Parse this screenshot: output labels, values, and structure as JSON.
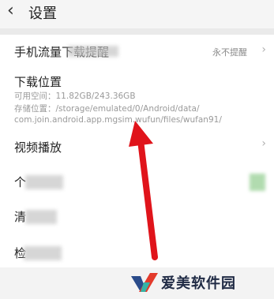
{
  "header": {
    "back_icon": "chevron-left-icon",
    "title": "设置"
  },
  "settings": {
    "row1": {
      "label": "手机流量下载提醒",
      "value": "永不提醒"
    },
    "row2": {
      "label": "下载位置",
      "available": "可用空间：11.82GB/243.36GB",
      "path_line1": "存储位置：/storage/emulated/0/Android/data/",
      "path_line2": "com.join.android.app.mgsim.wufun/files/wufan91/"
    },
    "row3": {
      "label": "视频播放"
    },
    "row4": {
      "label": "个"
    },
    "row5": {
      "label": "清"
    },
    "row6": {
      "label": "检"
    }
  },
  "overlay": {
    "arrow_color": "#e0141b"
  },
  "watermark": {
    "text": "爱美软件园"
  }
}
